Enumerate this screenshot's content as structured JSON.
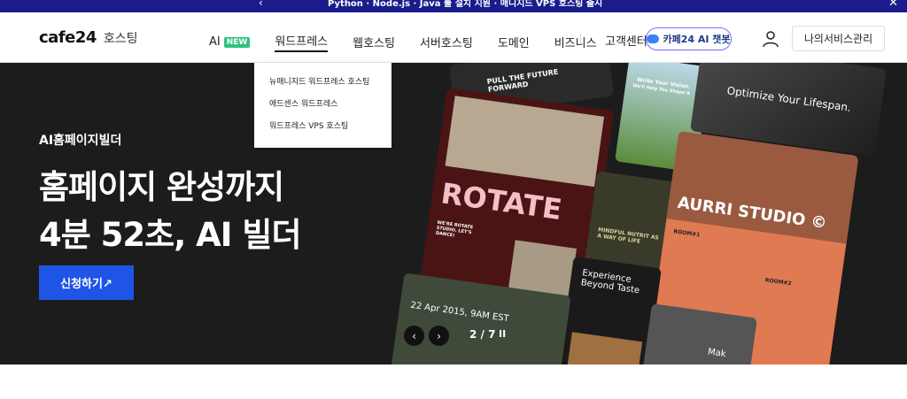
{
  "notice": {
    "text": "Python · Node.js · Java 툴 설치 지원 · 매니지드 VPS 호스팅 출시"
  },
  "header": {
    "brand": "cafe24",
    "brand_sub": "호스팅",
    "nav": [
      {
        "label": "AI",
        "badge": "NEW"
      },
      {
        "label": "워드프레스"
      },
      {
        "label": "웹호스팅"
      },
      {
        "label": "서버호스팅"
      },
      {
        "label": "도메인"
      },
      {
        "label": "비즈니스"
      }
    ],
    "support": "고객센터",
    "chatbot": "카페24 AI 챗봇",
    "my_services": "나의서비스관리"
  },
  "dropdown": {
    "items": [
      "뉴매니지드 워드프레스 호스팅",
      "애드센스 워드프레스",
      "워드프레스 VPS 호스팅"
    ]
  },
  "hero": {
    "kicker": "AI홈페이지빌더",
    "headline_1": "홈페이지 완성까지",
    "headline_2": "4분 52초, AI 빌더",
    "cta": "신청하기↗"
  },
  "collage": {
    "card1": "PULL THE FUTURE FORWARD",
    "card2a": "Write Your Vision.",
    "card2b": "We'll Help You Shape It",
    "card3": "Optimize Your Lifespan.",
    "card4": "ROTATE",
    "card4sub": "WE'RE ROTATE STUDIO. LET'S DANCE!",
    "card5": "MINDFUL NUTRIT AS A WAY OF LIFE",
    "card6": "AURRI STUDIO ©",
    "card6a": "ROOM#1",
    "card6b": "ROOM#2",
    "card7": "Experience Beyond Taste",
    "card8": "22 Apr 2015, 9AM EST",
    "card9": "Mak"
  },
  "slider": {
    "page": "2 / 7"
  },
  "colors": {
    "topbar": "#1a1c8c",
    "cta": "#1f55e6",
    "new_badge": "#2ec27e",
    "hero_bg": "#1c1c1c"
  }
}
